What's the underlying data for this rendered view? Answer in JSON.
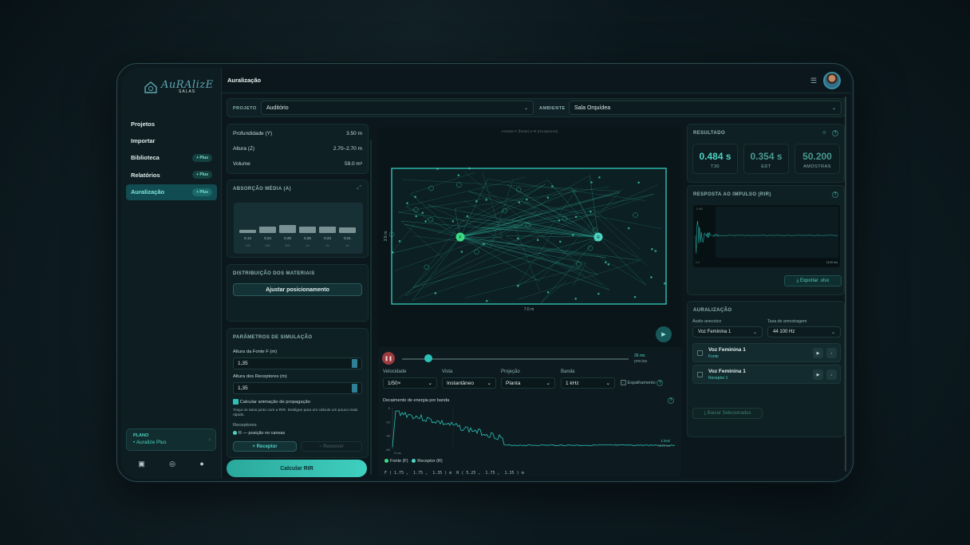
{
  "app": {
    "logo_main": "AuRAlizE",
    "logo_sub": "SALAS",
    "page_title": "Auralização"
  },
  "sidebar": {
    "items": [
      {
        "label": "Projetos",
        "badge": ""
      },
      {
        "label": "Importar",
        "badge": ""
      },
      {
        "label": "Biblioteca",
        "badge": "+ Plus"
      },
      {
        "label": "Relatórios",
        "badge": "+ Plus"
      },
      {
        "label": "Auralização",
        "badge": "+ Plus",
        "active": true
      }
    ],
    "plan": {
      "label": "PLANO",
      "name": "• Auralize Plus"
    }
  },
  "project": {
    "label": "PROJETO",
    "value": "Auditório",
    "env_label": "AMBIENTE",
    "env_value": "Sala Orquídea"
  },
  "dimensions": {
    "depth_label": "Profundidade (Y)",
    "depth_value": "3.50 m",
    "height_label": "Altura (Z)",
    "height_value": "2.70–2.70 m",
    "volume_label": "Volume",
    "volume_value": "59.0 m³"
  },
  "absorption": {
    "title": "ABSORÇÃO MÉDIA (A)",
    "bands": [
      {
        "label": "125",
        "value": "0.13",
        "level": 0.13
      },
      {
        "label": "250",
        "value": "0.24",
        "level": 0.24
      },
      {
        "label": "500",
        "value": "0.28",
        "level": 0.28
      },
      {
        "label": "1k",
        "value": "0.25",
        "level": 0.25
      },
      {
        "label": "2k",
        "value": "0.23",
        "level": 0.23
      },
      {
        "label": "4k",
        "value": "0.21",
        "level": 0.21
      }
    ]
  },
  "materials": {
    "title": "DISTRIBUIÇÃO DOS MATERIAIS",
    "button": "Ajustar posicionamento"
  },
  "simulation": {
    "title": "PARÂMETROS DE SIMULAÇÃO",
    "source_height_label": "Altura da Fonte F (m)",
    "source_height_value": "1,35",
    "receiver_height_label": "Altura dos Receptores (m)",
    "receiver_height_value": "1,35",
    "animate_label": "Calcular animação de propagação",
    "hint": "Traça os raios junto com a RIR. Desligue para um cálculo um pouco mais rápido.",
    "receivers_label": "Receptores",
    "receiver_item": "R — posição no canvas",
    "add_receiver": "+ Receptor",
    "remove": "− Remover",
    "calc_button": "Calcular RIR"
  },
  "canvas": {
    "caption": "Arraste F (fonte) e R (receptores)",
    "width_label": "7.0 m",
    "height_label": "3.5 m",
    "source": "F",
    "receiver": "R"
  },
  "playback": {
    "time_value": "26 ms",
    "time_sub": "precisa",
    "speed_label": "Velocidade",
    "speed_value": "1/50×",
    "view_label": "Vista",
    "view_value": "Instantâneo",
    "projection_label": "Projeção",
    "projection_value": "Planta",
    "band_label": "Banda",
    "band_value": "1 kHz",
    "scatter_label": "Espalhamento",
    "decay_title": "Decaimento de energia por banda",
    "decay_band": "1 kHz",
    "decay_end": "1133 ms",
    "decay_start": "0 ms",
    "decay_ticks": [
      "0",
      "-20",
      "-40",
      "-60"
    ],
    "legend_source": "Fonte (F)",
    "legend_receiver": "Receptor (R)",
    "coords": "F ( 1.75 ,  1.75 ,  1.35 ) m  R ( 5.25 ,  1.75 ,  1.35 ) m"
  },
  "result": {
    "title": "RESULTADO",
    "stats": [
      {
        "value": "0.484 s",
        "unit": "T30",
        "color": "#4ed3c2"
      },
      {
        "value": "0.354 s",
        "unit": "EDT",
        "color": "#4a9a92"
      },
      {
        "value": "50.200",
        "unit": "AMOSTRAS",
        "color": "#4a9a92"
      }
    ]
  },
  "rir": {
    "title": "RESPOSTA AO IMPULSO (RIR)",
    "y_top": "0 dB",
    "x_start": "0 s",
    "x_end": "1133 ms",
    "export": "⤓ Exportar .xlsx"
  },
  "auralization": {
    "title": "AURALIZAÇÃO",
    "audio_label": "Áudio anecoico",
    "audio_value": "Voz Feminina 1",
    "rate_label": "Taxa de amostragem",
    "rate_value": "44 100 Hz",
    "items": [
      {
        "name": "Voz Feminina 1",
        "sub": "Fonte"
      },
      {
        "name": "Voz Feminina 1",
        "sub": "Receptor 1"
      }
    ],
    "download": "⤓ Baixar Selecionados"
  },
  "colors": {
    "accent": "#2cc1b4",
    "source": "#3ddc84",
    "receiver": "#4ed3c2"
  }
}
